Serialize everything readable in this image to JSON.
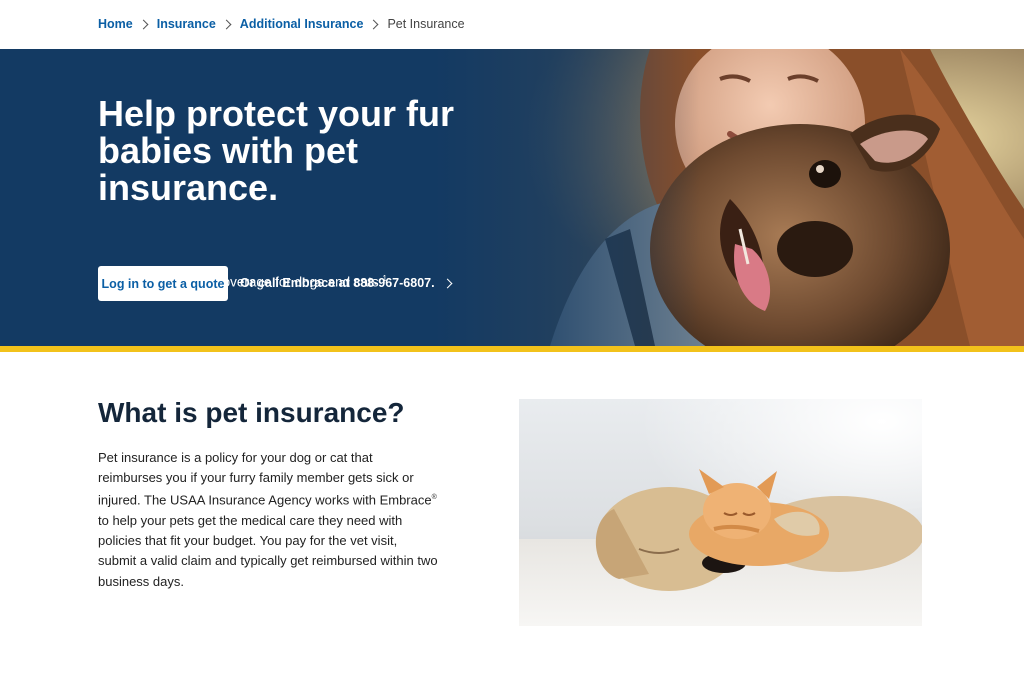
{
  "breadcrumb": {
    "items": [
      "Home",
      "Insurance",
      "Additional Insurance"
    ],
    "current": "Pet Insurance"
  },
  "hero": {
    "title": "Help protect your fur babies with pet insurance.",
    "subtitle": "Save up to 25% on coverage for dogs and cats.",
    "subtitle_footnote": "1",
    "cta_label": "Log in to get a quote",
    "call_text": "Or call Embrace at 888-967-6807."
  },
  "content": {
    "title": "What is pet insurance?",
    "body_part1": "Pet insurance is a policy for your dog or cat that reimburses you if your furry family member gets sick or injured. The USAA Insurance Agency works with Embrace",
    "body_mark": "®",
    "body_part2": " to help your pets get the medical care they need with policies that fit your budget. You pay for the vet visit, submit a valid claim and typically get reimbursed within two business days."
  },
  "colors": {
    "hero_navy": "#133a63",
    "link_blue": "#0b5fa5",
    "accent_gold": "#f2c21b",
    "heading_dark": "#14263a"
  },
  "icons": [
    "chevron-right-icon"
  ]
}
